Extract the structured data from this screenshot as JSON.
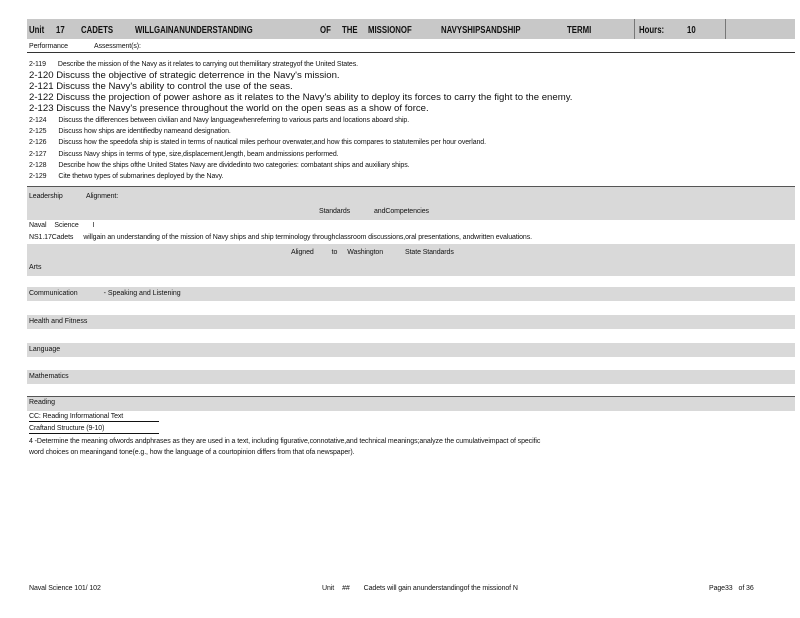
{
  "header": {
    "unit_label": "Unit",
    "unit_number": "17",
    "title_1": "CADETS",
    "title_2": "WILLGAINANUNDERSTANDING",
    "title_3": "OF",
    "title_4": "THE",
    "title_5": "MISSIONOF",
    "title_6": "NAVYSHIPSANDSHIP",
    "title_7": "TERMI",
    "hours_label": "Hours:",
    "hours_value": "10"
  },
  "subheader": {
    "performance": "Performance",
    "assessments": "Assessment(s):"
  },
  "objectives": [
    {
      "num": "2-119",
      "text": "Describe the mission of the Navy as it relates to carrying out themilitary strategyof the United States."
    },
    {
      "num": "2-120",
      "text": "Discuss the objective of strategic deterrence in the Navy's mission."
    },
    {
      "num": "2-121",
      "text": "Discuss the Navy's ability to control the use of the seas."
    },
    {
      "num": "2-122",
      "text": "Discuss the projection of power ashore as it relates to the Navy's ability to deploy its forces to carry the fight to the enemy."
    },
    {
      "num": "2-123",
      "text": "Discuss the Navy's presence throughout the world on the open seas as a show of force."
    },
    {
      "num": "2-124",
      "text": "Discuss the differences between civilian and Navy languagewhenreferring to various parts and locations aboard ship."
    },
    {
      "num": "2-125",
      "text": "Discuss how ships are identifiedby nameand designation."
    },
    {
      "num": "2-126",
      "text": "Discuss how the speedofa ship is stated in terms of nautical miles perhour overwater,and how this compares to statutemiles per hour overland."
    },
    {
      "num": "2-127",
      "text": "Discuss Navy ships in terms of type, size,displacement,length, beam andmissions performed."
    },
    {
      "num": "2-128",
      "text": "Describe how the ships ofthe United States Navy are dividedinto two categories: combatant ships and auxiliary ships."
    },
    {
      "num": "2-129",
      "text": "Cite thetwo types of submarines deployed by the Navy."
    }
  ],
  "leadership": {
    "label": "Leadership",
    "alignment": "Alignment:"
  },
  "standards_heading": {
    "w1": "Standards",
    "w2": "andCompetencies"
  },
  "naval_science": {
    "label": "Naval",
    "label2": "Science",
    "mark": "I"
  },
  "ns_standard": {
    "code": "NS1.17Cadets",
    "text": "willgain an understanding of the mission of Navy ships and ship terminology throughclassroom discussions,oral presentations, andwritten evaluations."
  },
  "washington_heading": {
    "w1": "Aligned",
    "w2": "to",
    "w3": "Washington",
    "w4": "State Standards"
  },
  "sections": {
    "arts": "Arts",
    "communication": "Communication",
    "communication_sub": "- Speaking and Listening",
    "health": "Health and Fitness",
    "language": "Language",
    "mathematics": "Mathematics",
    "reading": "Reading"
  },
  "reading": {
    "cc_line": "CC: Reading Informational Text",
    "craft_line": "Craftand Structure (9-10)",
    "standard_line1": "4 -Determine the meaning ofwords andphrases as they are used in a text, including figurative,connotative,and technical meanings;analyze the cumulativeimpact of specific",
    "standard_line2": "word choices on meaningand tone(e.g., how the language of a courtopinion differs from that ofa newspaper)."
  },
  "footer": {
    "left": "Naval Science 101/ 102",
    "center_unit": "Unit",
    "center_num": "##",
    "center_text": "Cadets will gain anunderstandingof the missionof N",
    "page": "Page33",
    "of": "of 36"
  }
}
